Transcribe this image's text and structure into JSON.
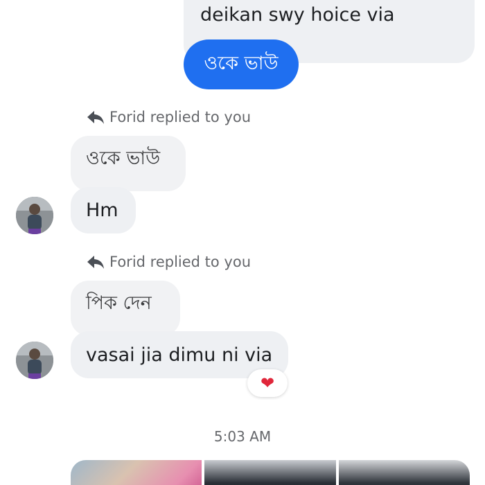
{
  "messages": {
    "outgoing_text": "deikan swy hoice via",
    "outgoing_button_text": "ওকে ভাউ",
    "reply1": {
      "label": "Forid replied to you",
      "quoted": "ওকে ভাউ",
      "message": "Hm"
    },
    "reply2": {
      "label": "Forid replied to you",
      "quoted": "পিক দেন",
      "message": "vasai jia dimu ni via",
      "reaction": "❤"
    },
    "timestamp": "5:03 AM"
  },
  "icons": {
    "reply": "reply-arrow-icon",
    "reaction": "heart-icon"
  },
  "colors": {
    "accent_blue": "#1f6ff0",
    "bubble_grey": "#eef0f3",
    "heart_red": "#e0263a"
  }
}
